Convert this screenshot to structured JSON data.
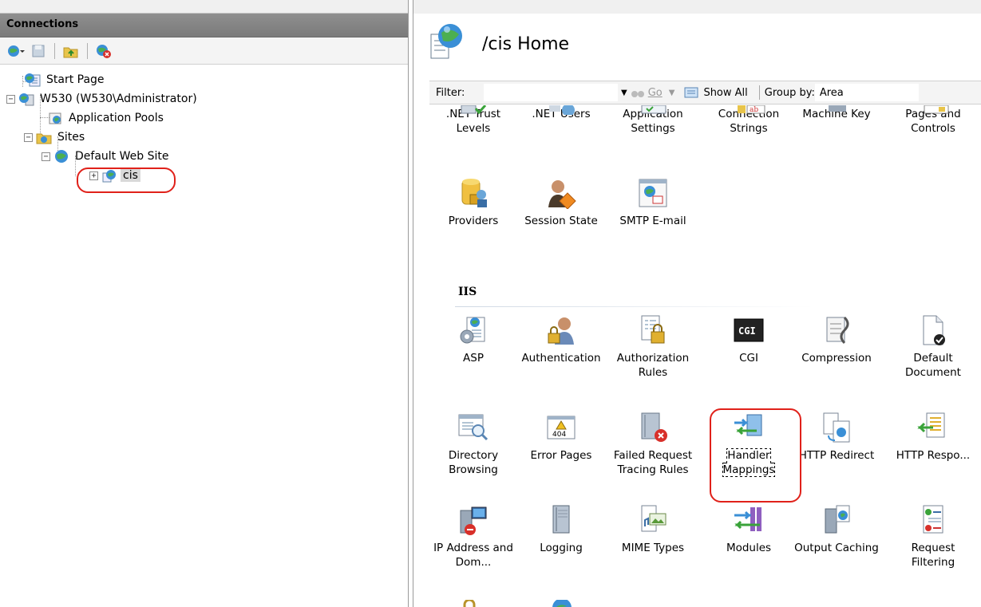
{
  "connections": {
    "header": "Connections",
    "tree": {
      "start_page": "Start Page",
      "server": "W530 (W530\\Administrator)",
      "app_pools": "Application Pools",
      "sites": "Sites",
      "default_site": "Default Web Site",
      "cis": "cis"
    }
  },
  "page": {
    "title": "/cis Home"
  },
  "filter_bar": {
    "filter_label": "Filter:",
    "go_label": "Go",
    "show_all_label": "Show All",
    "group_by_label": "Group by:",
    "group_by_value": "Area"
  },
  "features": {
    "aspnet_row1": [
      {
        "label": ".NET Trust Levels",
        "icon": "trust-icon"
      },
      {
        "label": ".NET Users",
        "icon": "users-icon"
      },
      {
        "label": "Application Settings",
        "icon": "settings-icon"
      },
      {
        "label": "Connection Strings",
        "icon": "connection-icon"
      },
      {
        "label": "Machine Key",
        "icon": "key-icon"
      },
      {
        "label": "Pages and Controls",
        "icon": "pages-icon"
      }
    ],
    "aspnet_row2": [
      {
        "label": "Providers",
        "icon": "providers-icon"
      },
      {
        "label": "Session State",
        "icon": "session-icon"
      },
      {
        "label": "SMTP E-mail",
        "icon": "email-icon"
      }
    ],
    "iis_group": "IIS",
    "iis_row1": [
      {
        "label": "ASP",
        "icon": "asp-icon"
      },
      {
        "label": "Authentication",
        "icon": "auth-icon"
      },
      {
        "label": "Authorization Rules",
        "icon": "authz-icon"
      },
      {
        "label": "CGI",
        "icon": "cgi-icon"
      },
      {
        "label": "Compression",
        "icon": "compression-icon"
      },
      {
        "label": "Default Document",
        "icon": "default-doc-icon"
      }
    ],
    "iis_row2": [
      {
        "label": "Directory Browsing",
        "icon": "dir-browse-icon"
      },
      {
        "label": "Error Pages",
        "icon": "error-pages-icon"
      },
      {
        "label": "Failed Request Tracing Rules",
        "icon": "failed-req-icon"
      },
      {
        "label": "Handler Mappings",
        "icon": "handler-icon"
      },
      {
        "label": "HTTP Redirect",
        "icon": "redirect-icon"
      },
      {
        "label": "HTTP Respo...",
        "icon": "http-resp-icon"
      }
    ],
    "iis_row3": [
      {
        "label": "IP Address and Dom...",
        "icon": "ip-icon"
      },
      {
        "label": "Logging",
        "icon": "logging-icon"
      },
      {
        "label": "MIME Types",
        "icon": "mime-icon"
      },
      {
        "label": "Modules",
        "icon": "modules-icon"
      },
      {
        "label": "Output Caching",
        "icon": "output-cache-icon"
      },
      {
        "label": "Request Filtering",
        "icon": "request-filter-icon"
      }
    ]
  },
  "colors": {
    "highlight": "#e0211a",
    "header_gray": "#8f8f8f"
  }
}
